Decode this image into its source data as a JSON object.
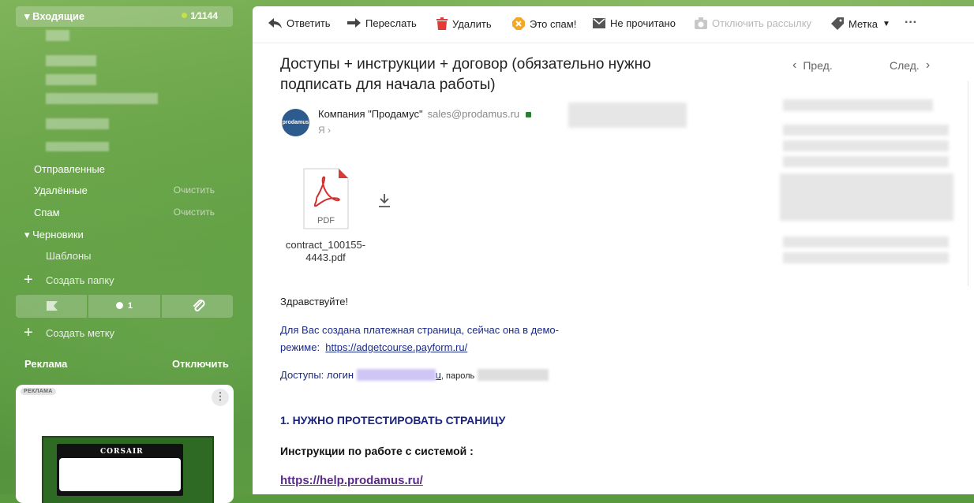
{
  "sidebar": {
    "inbox": {
      "label": "▾ Входящие",
      "count": "1⁄1144"
    },
    "folders": {
      "sent": "Отправленные",
      "deleted": "Удалённые",
      "spam": "Спам",
      "drafts": "▾ Черновики",
      "templates": "Шаблоны",
      "clean1": "Очистить",
      "clean2": "Очистить"
    },
    "create_folder": "Создать папку",
    "create_label": "Создать метку",
    "filter_unread_count": "1",
    "ad": {
      "title": "Реклама",
      "disable": "Отключить",
      "badge": "РЕКЛАМА",
      "brand": "CORSAIR"
    }
  },
  "toolbar": {
    "reply": "Ответить",
    "forward": "Переслать",
    "delete": "Удалить",
    "spam": "Это спам!",
    "unread": "Не прочитано",
    "unsubscribe": "Отключить рассылку",
    "label": "Метка",
    "more": "···"
  },
  "message": {
    "subject": "Доступы + инструкции + договор (обязательно нужно подписать для начала работы)",
    "prev": "Пред.",
    "next": "След.",
    "sender_name": "Компания \"Продамус\"",
    "sender_email": "sales@prodamus.ru",
    "to": "Я",
    "avatar_text": "prodamus",
    "attachment": {
      "type": "PDF",
      "name": "contract_100155-4443.pdf"
    },
    "greeting": "Здравствуйте!",
    "line1": "Для Вас создана платежная страница, сейчас она в демо-",
    "line2_prefix": "режиме:",
    "line2_link": "https://adgetcourse.payform.ru/",
    "access_prefix": "Доступы:  логин",
    "access_login_tail": "u",
    "access_password": ", пароль",
    "heading1": "1. НУЖНО ПРОТЕСТИРОВАТЬ СТРАНИЦУ",
    "heading2": "Инструкции по работе с системой :",
    "help_link": "https://help.prodamus.ru/"
  },
  "colors": {
    "accent": "#1a237e",
    "sidebar_green": "#5e9b3f",
    "spam_orange": "#f5a623",
    "delete_red": "#e53935"
  }
}
